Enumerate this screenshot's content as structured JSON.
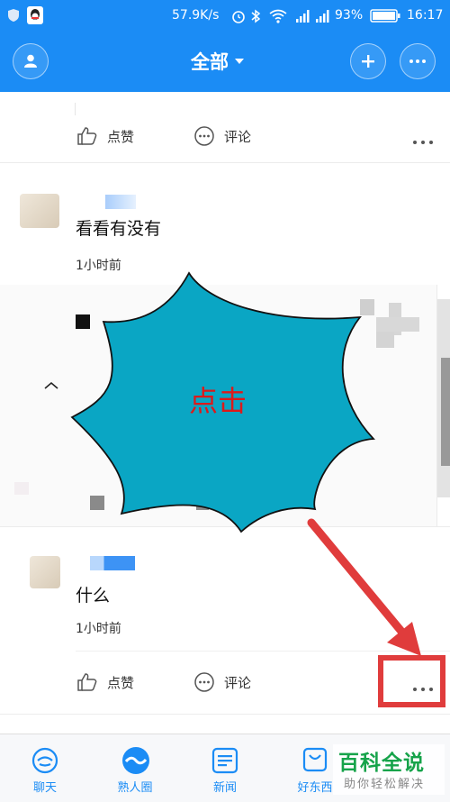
{
  "status_bar": {
    "speed": "57.9K/s",
    "battery": "93%",
    "time": "16:17"
  },
  "header": {
    "title": "全部"
  },
  "post_actions": {
    "like": "点赞",
    "comment": "评论"
  },
  "posts": [
    {
      "text": "看看有没有",
      "time": "1小时前"
    },
    {
      "text": "什么",
      "time": "1小时前"
    }
  ],
  "annotation": {
    "bubble_text": "点击",
    "bubble_color": "#0aa6c4",
    "bubble_text_color": "#dd1a1a",
    "arrow_color": "#e03c3c"
  },
  "nav": {
    "items": [
      "聊天",
      "熟人圈",
      "新闻",
      "好东西"
    ],
    "active_color": "#1b8cf5"
  },
  "watermark": {
    "title": "百科全说",
    "subtitle": "助你轻松解决"
  }
}
